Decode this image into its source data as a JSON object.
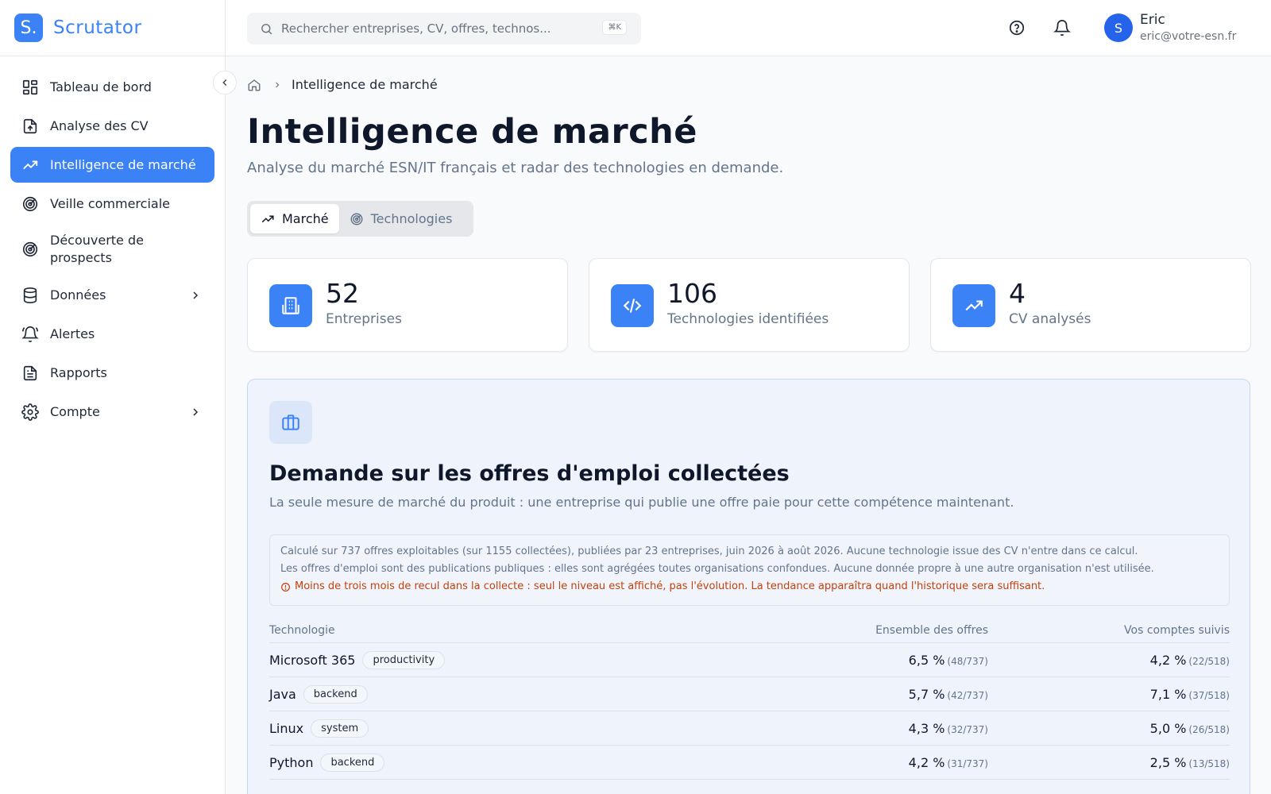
{
  "brand": {
    "logo": "S.",
    "name": "Scrutator",
    "accent": "#3b82f6"
  },
  "sidebar": {
    "items": [
      {
        "label": "Tableau de bord",
        "icon": "dashboard-icon"
      },
      {
        "label": "Analyse des CV",
        "icon": "file-upload-icon"
      },
      {
        "label": "Intelligence de marché",
        "icon": "trending-up-icon",
        "active": true
      },
      {
        "label": "Veille commerciale",
        "icon": "radar-icon"
      },
      {
        "label": "Découverte de prospects",
        "icon": "radar-icon"
      },
      {
        "label": "Données",
        "icon": "database-icon",
        "expandable": true
      },
      {
        "label": "Alertes",
        "icon": "bell-ring-icon"
      },
      {
        "label": "Rapports",
        "icon": "document-icon"
      },
      {
        "label": "Compte",
        "icon": "gear-icon",
        "expandable": true
      }
    ]
  },
  "topbar": {
    "search_placeholder": "Rechercher entreprises, CV, offres, technos...",
    "search_shortcut": "⌘K",
    "user": {
      "initial": "S",
      "name": "Eric",
      "email": "eric@votre-esn.fr"
    }
  },
  "breadcrumb": {
    "current": "Intelligence de marché"
  },
  "page": {
    "title": "Intelligence de marché",
    "subtitle": "Analyse du marché ESN/IT français et radar des technologies en demande."
  },
  "tabs": [
    {
      "label": "Marché",
      "active": true
    },
    {
      "label": "Technologies",
      "active": false
    }
  ],
  "stats": [
    {
      "value": "52",
      "label": "Entreprises"
    },
    {
      "value": "106",
      "label": "Technologies identifiées"
    },
    {
      "value": "4",
      "label": "CV analysés"
    }
  ],
  "demand": {
    "title": "Demande sur les offres d'emploi collectées",
    "subtitle": "La seule mesure de marché du produit : une entreprise qui publie une offre paie pour cette compétence maintenant.",
    "notice_line1": "Calculé sur 737 offres exploitables (sur 1155 collectées), publiées par 23 entreprises, juin 2026 à août 2026. Aucune technologie issue des CV n'entre dans ce calcul.",
    "notice_line2": "Les offres d'emploi sont des publications publiques : elles sont agrégées toutes organisations confondues. Aucune donnée propre à une autre organisation n'est utilisée.",
    "notice_warning": "Moins de trois mois de recul dans la collecte : seul le niveau est affiché, pas l'évolution. La tendance apparaîtra quand l'historique sera suffisant.",
    "columns": [
      "Technologie",
      "Ensemble des offres",
      "Vos comptes suivis"
    ],
    "rows": [
      {
        "tech": "Microsoft 365",
        "tag": "productivity",
        "all_pct": "6,5 %",
        "all_frac": "(48/737)",
        "acc_pct": "4,2 %",
        "acc_frac": "(22/518)"
      },
      {
        "tech": "Java",
        "tag": "backend",
        "all_pct": "5,7 %",
        "all_frac": "(42/737)",
        "acc_pct": "7,1 %",
        "acc_frac": "(37/518)"
      },
      {
        "tech": "Linux",
        "tag": "system",
        "all_pct": "4,3 %",
        "all_frac": "(32/737)",
        "acc_pct": "5,0 %",
        "acc_frac": "(26/518)"
      },
      {
        "tech": "Python",
        "tag": "backend",
        "all_pct": "4,2 %",
        "all_frac": "(31/737)",
        "acc_pct": "2,5 %",
        "acc_frac": "(13/518)"
      }
    ]
  }
}
